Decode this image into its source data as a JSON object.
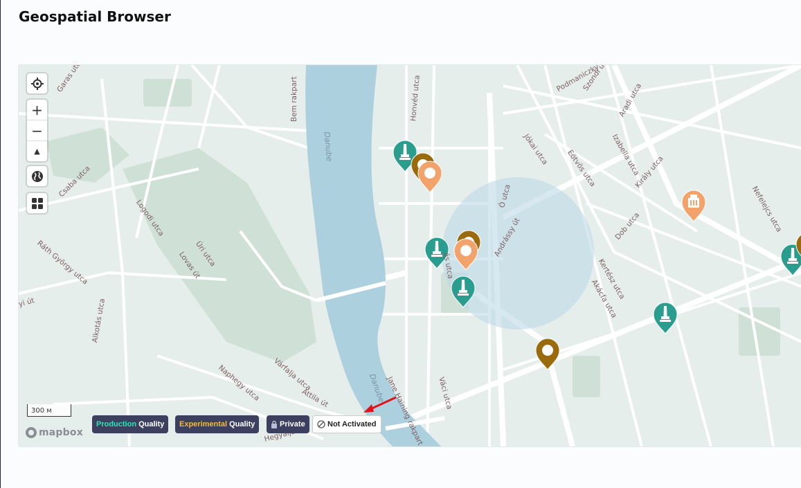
{
  "page": {
    "title": "Geospatial Browser"
  },
  "map": {
    "controls": {
      "locate_icon": "crosshair-icon",
      "zoom_in": "+",
      "zoom_out": "−",
      "compass": "▲",
      "globe_icon": "globe-icon",
      "layers_icon": "grid-icon"
    },
    "scale": "300 м",
    "attribution_logo": "mapbox",
    "streets": [
      {
        "name": "Garas utca"
      },
      {
        "name": "Bem rakpart"
      },
      {
        "name": "Danube"
      },
      {
        "name": "Honvéd utca"
      },
      {
        "name": "Podmaniczky"
      },
      {
        "name": "Szondi utca"
      },
      {
        "name": "Aradi utca"
      },
      {
        "name": "Izabella utca"
      },
      {
        "name": "Jókai utca"
      },
      {
        "name": "Eötvös utca"
      },
      {
        "name": "Király utca"
      },
      {
        "name": "Csaba utca"
      },
      {
        "name": "Logodi utca"
      },
      {
        "name": "Úri utca"
      },
      {
        "name": "Lovas út"
      },
      {
        "name": "Ráth György utca"
      },
      {
        "name": "Ó utca"
      },
      {
        "name": "Andrássy út"
      },
      {
        "name": "Dob utca"
      },
      {
        "name": "Kertész utca"
      },
      {
        "name": "Akácfa utca"
      },
      {
        "name": "Nefelejcs utca"
      },
      {
        "name": "Alkotás utca"
      },
      {
        "name": "Naphegy utca"
      },
      {
        "name": "Attila út"
      },
      {
        "name": "Jane Haining rakpart"
      },
      {
        "name": "Váci utca"
      },
      {
        "name": "Danube"
      },
      {
        "name": "ás utca"
      },
      {
        "name": "yi út"
      },
      {
        "name": "Várfalja utca"
      },
      {
        "name": "Hegyalja út"
      }
    ],
    "legend": {
      "production": {
        "accent": "Production",
        "rest": " Quality",
        "accent_color": "#2ee6b8"
      },
      "experimental": {
        "accent": "Experimental",
        "rest": " Quality",
        "accent_color": "#f4b942"
      },
      "private": {
        "icon": "lock-icon",
        "label": "Private"
      },
      "not_activated": {
        "icon": "no-entry-icon",
        "label": "Not Activated"
      }
    },
    "pin_colors": {
      "teal": "#2a9d8f",
      "gold": "#9a6b0c",
      "orange": "#f2a36b"
    },
    "pins": [
      {
        "color": "teal",
        "icon": "monument-icon"
      },
      {
        "color": "gold",
        "icon": "circle-icon"
      },
      {
        "color": "orange",
        "icon": "circle-icon"
      },
      {
        "color": "teal",
        "icon": "monument-icon"
      },
      {
        "color": "gold",
        "icon": "circle-icon"
      },
      {
        "color": "orange",
        "icon": "circle-icon"
      },
      {
        "color": "teal",
        "icon": "monument-icon"
      },
      {
        "color": "gold",
        "icon": "circle-icon"
      },
      {
        "color": "orange",
        "icon": "building-icon"
      },
      {
        "color": "teal",
        "icon": "monument-icon"
      },
      {
        "color": "teal",
        "icon": "monument-icon"
      },
      {
        "color": "gold",
        "icon": "circle-icon"
      }
    ],
    "arrow_color": "#e0131b"
  }
}
